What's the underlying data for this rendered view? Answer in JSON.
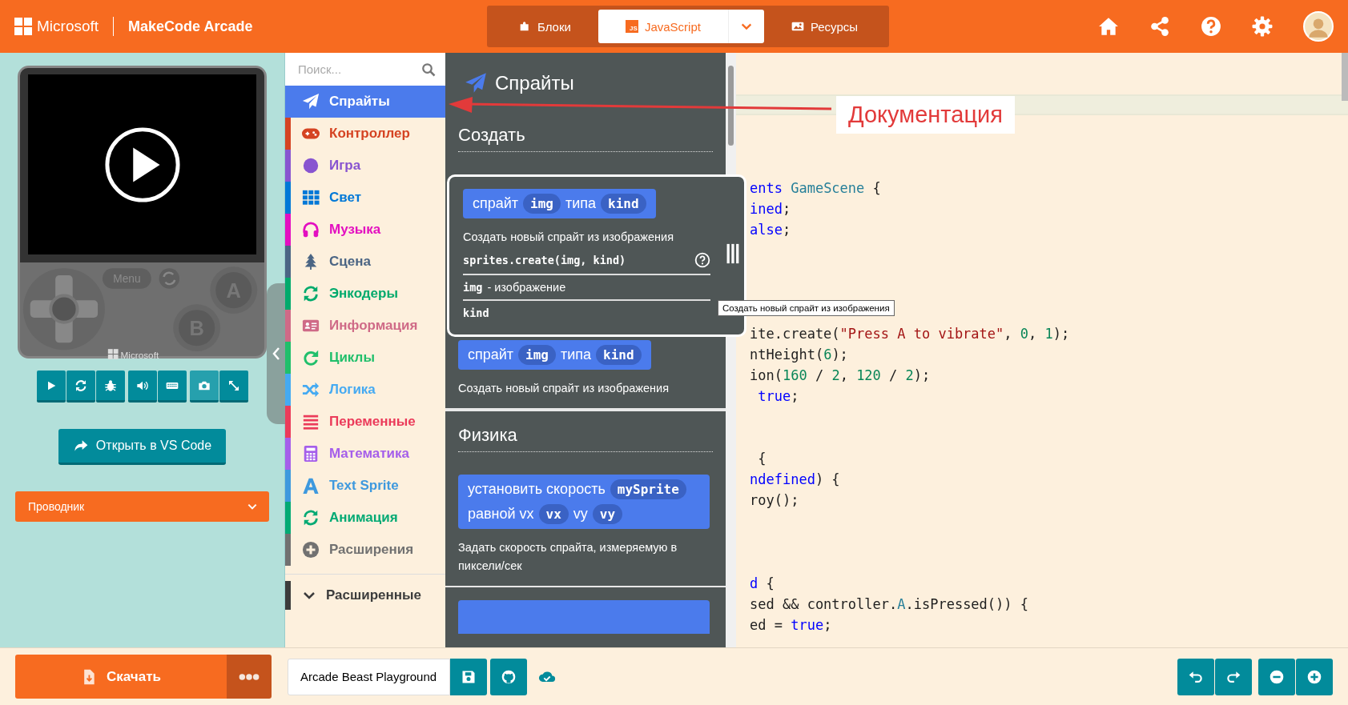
{
  "header": {
    "brand": "Microsoft",
    "product": "MakeCode Arcade",
    "tabs": [
      {
        "label": "Блоки",
        "selected": false
      },
      {
        "label": "JavaScript",
        "badge": "JS",
        "selected": true
      },
      {
        "label": "Ресурсы",
        "selected": false
      }
    ]
  },
  "simulator": {
    "menu_label": "Menu",
    "a_label": "A",
    "b_label": "B",
    "logo_text": "Microsoft",
    "open_button": "Открыть в VS Code",
    "explorer": {
      "label": "Проводник",
      "expanded": false
    }
  },
  "toolbox": {
    "search_placeholder": "Поиск...",
    "categories": [
      {
        "label": "Спрайты",
        "color": "#4b7bec",
        "selected": true
      },
      {
        "label": "Контроллер",
        "color": "#d54322",
        "selected": false
      },
      {
        "label": "Игра",
        "color": "#8854d0",
        "selected": false
      },
      {
        "label": "Свет",
        "color": "#0078d7",
        "selected": false
      },
      {
        "label": "Музыка",
        "color": "#e30fc0",
        "selected": false
      },
      {
        "label": "Сцена",
        "color": "#4b6584",
        "selected": false
      },
      {
        "label": "Энкодеры",
        "color": "#00aa6c",
        "selected": false
      },
      {
        "label": "Информация",
        "color": "#cf6a87",
        "selected": false
      },
      {
        "label": "Циклы",
        "color": "#20bf6b",
        "selected": false
      },
      {
        "label": "Логика",
        "color": "#45aaf2",
        "selected": false
      },
      {
        "label": "Переменные",
        "color": "#eb3b5a",
        "selected": false
      },
      {
        "label": "Математика",
        "color": "#a55eea",
        "selected": false
      },
      {
        "label": "Text Sprite",
        "color": "#3e99de",
        "selected": false
      },
      {
        "label": "Анимация",
        "color": "#03aa74",
        "selected": false
      },
      {
        "label": "Расширения",
        "color": "#717171",
        "selected": false
      }
    ],
    "advanced": {
      "label": "Расширенные",
      "color": "#3c3c3c",
      "expanded": false
    }
  },
  "flyout": {
    "title": "Спрайты",
    "more_below": true,
    "sections": [
      {
        "heading": "Создать",
        "blocks": [
          {
            "parts": [
              {
                "kind": "text",
                "text": "спрайт"
              },
              {
                "kind": "param",
                "text": "img"
              },
              {
                "kind": "text",
                "text": "типа"
              },
              {
                "kind": "param",
                "text": "kind"
              }
            ],
            "description": "Создать новый спрайт из изображения",
            "expanded": true,
            "signature": "sprites.create(img, kind)",
            "params": [
              {
                "name": "img",
                "text": "- изображение"
              },
              {
                "name": "kind"
              }
            ]
          },
          {
            "parts": [
              {
                "kind": "text",
                "text": "спрайт"
              },
              {
                "kind": "param",
                "text": "img"
              },
              {
                "kind": "text",
                "text": "типа"
              },
              {
                "kind": "param",
                "text": "kind"
              }
            ],
            "description": "Создать новый спрайт из изображения",
            "expanded": false
          }
        ]
      },
      {
        "heading": "Физика",
        "blocks": [
          {
            "parts": [
              {
                "kind": "text",
                "text": "установить скорость"
              },
              {
                "kind": "param",
                "text": "mySprite"
              },
              {
                "kind": "text",
                "text": "равной vx"
              },
              {
                "kind": "param",
                "text": "vx"
              },
              {
                "kind": "text",
                "text": "vy"
              },
              {
                "kind": "param",
                "text": "vy"
              }
            ],
            "description": "Задать скорость спрайта, измеряемую в пиксели/сек",
            "expanded": false
          }
        ]
      }
    ]
  },
  "tooltip": {
    "text": "Создать новый спрайт из изображения"
  },
  "annotation": {
    "text": "Документация"
  },
  "editor": {
    "lines": [
      {
        "kind": "blank",
        "current": false
      },
      {
        "kind": "blank",
        "current": false
      },
      {
        "kind": "blank",
        "current": true
      },
      {
        "kind": "blank",
        "current": false
      },
      {
        "kind": "blank",
        "current": false
      },
      {
        "kind": "blank",
        "current": false
      },
      {
        "kind": "code",
        "current": false,
        "segments": [
          {
            "kind": "keyword",
            "text": "ents"
          },
          {
            "kind": "type",
            "text": " GameScene"
          },
          {
            "kind": "plain",
            "text": " {"
          }
        ]
      },
      {
        "kind": "code",
        "current": false,
        "segments": [
          {
            "kind": "keyword",
            "text": "ined"
          },
          {
            "kind": "plain",
            "text": ";"
          }
        ]
      },
      {
        "kind": "code",
        "current": false,
        "segments": [
          {
            "kind": "keyword",
            "text": "alse"
          },
          {
            "kind": "plain",
            "text": ";"
          }
        ]
      },
      {
        "kind": "blank",
        "current": false
      },
      {
        "kind": "blank",
        "current": false
      },
      {
        "kind": "blank",
        "current": false
      },
      {
        "kind": "blank",
        "current": false
      },
      {
        "kind": "code",
        "current": false,
        "segments": [
          {
            "kind": "plain",
            "text": "ite.create("
          },
          {
            "kind": "string",
            "text": "\"Press A to vibrate\""
          },
          {
            "kind": "plain",
            "text": ", "
          },
          {
            "kind": "number",
            "text": "0"
          },
          {
            "kind": "plain",
            "text": ", "
          },
          {
            "kind": "number",
            "text": "1"
          },
          {
            "kind": "plain",
            "text": ");"
          }
        ]
      },
      {
        "kind": "code",
        "current": false,
        "segments": [
          {
            "kind": "plain",
            "text": "ntHeight("
          },
          {
            "kind": "number",
            "text": "6"
          },
          {
            "kind": "plain",
            "text": ");"
          }
        ]
      },
      {
        "kind": "code",
        "current": false,
        "segments": [
          {
            "kind": "plain",
            "text": "ion("
          },
          {
            "kind": "number",
            "text": "160"
          },
          {
            "kind": "plain",
            "text": " / "
          },
          {
            "kind": "number",
            "text": "2"
          },
          {
            "kind": "plain",
            "text": ", "
          },
          {
            "kind": "number",
            "text": "120"
          },
          {
            "kind": "plain",
            "text": " / "
          },
          {
            "kind": "number",
            "text": "2"
          },
          {
            "kind": "plain",
            "text": ");"
          }
        ]
      },
      {
        "kind": "code",
        "current": false,
        "segments": [
          {
            "kind": "keyword",
            "text": " true"
          },
          {
            "kind": "plain",
            "text": ";"
          }
        ]
      },
      {
        "kind": "blank",
        "current": false
      },
      {
        "kind": "blank",
        "current": false
      },
      {
        "kind": "code",
        "current": false,
        "segments": [
          {
            "kind": "plain",
            "text": " {"
          }
        ]
      },
      {
        "kind": "code",
        "current": false,
        "segments": [
          {
            "kind": "keyword",
            "text": "ndefined"
          },
          {
            "kind": "plain",
            "text": ") {"
          }
        ]
      },
      {
        "kind": "code",
        "current": false,
        "segments": [
          {
            "kind": "plain",
            "text": "roy();"
          }
        ]
      },
      {
        "kind": "blank",
        "current": false
      },
      {
        "kind": "blank",
        "current": false
      },
      {
        "kind": "blank",
        "current": false
      },
      {
        "kind": "code",
        "current": false,
        "segments": [
          {
            "kind": "keyword",
            "text": "d"
          },
          {
            "kind": "plain",
            "text": " {"
          }
        ]
      },
      {
        "kind": "code",
        "current": false,
        "segments": [
          {
            "kind": "plain",
            "text": "sed && controller."
          },
          {
            "kind": "type",
            "text": "A"
          },
          {
            "kind": "plain",
            "text": ".isPressed()) {"
          }
        ]
      },
      {
        "kind": "code",
        "current": false,
        "segments": [
          {
            "kind": "plain",
            "text": "ed = "
          },
          {
            "kind": "keyword",
            "text": "true"
          },
          {
            "kind": "plain",
            "text": ";"
          }
        ]
      }
    ]
  },
  "footer": {
    "download": "Скачать",
    "project_name": "Arcade Beast Playground"
  }
}
